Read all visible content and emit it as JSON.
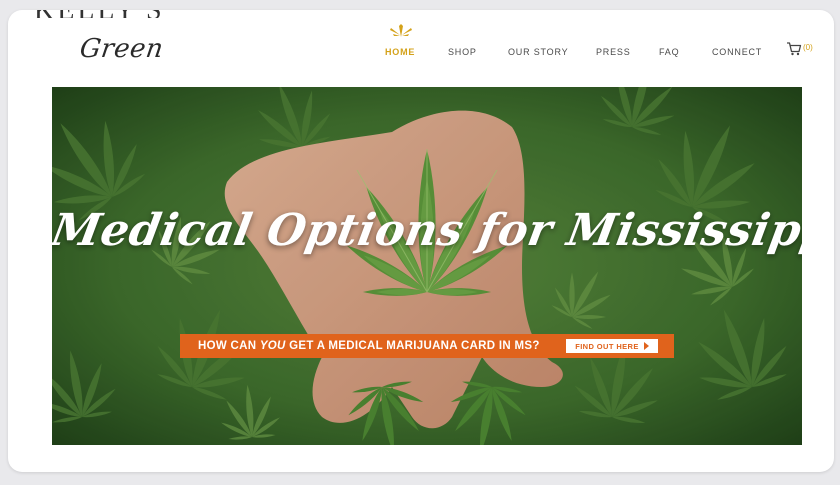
{
  "brand": {
    "logo_top": "KELLY'S",
    "logo_script": "Green"
  },
  "nav": {
    "items": [
      {
        "label": "HOME",
        "active": true
      },
      {
        "label": "SHOP",
        "active": false
      },
      {
        "label": "OUR STORY",
        "active": false
      },
      {
        "label": "PRESS",
        "active": false
      },
      {
        "label": "FAQ",
        "active": false
      },
      {
        "label": "CONNECT",
        "active": false
      }
    ],
    "cart_icon": "shopping-cart-icon",
    "cart_count": "(0)"
  },
  "hero": {
    "title": "Medical Options for Mississippi",
    "cta_prefix": "HOW CAN ",
    "cta_emphasis": "YOU",
    "cta_suffix": " GET A MEDICAL MARIJUANA CARD IN MS?",
    "cta_button": "FIND OUT HERE",
    "cta_button_icon": "play-arrow-icon"
  },
  "colors": {
    "accent_gold": "#d4a21a",
    "cta_orange": "#e0631c",
    "leaf_green": "#3d6b2e"
  }
}
